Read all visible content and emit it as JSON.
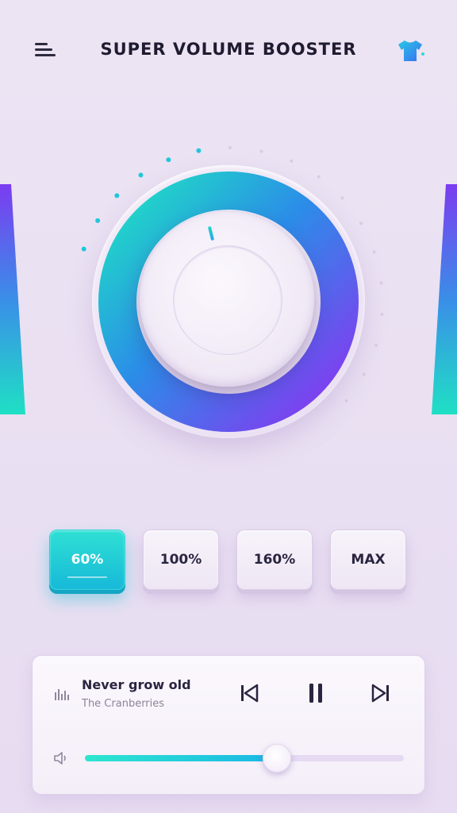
{
  "header": {
    "title": "SUPER VOLUME BOOSTER",
    "menu_icon": "hamburger-menu-icon",
    "theme_icon": "tshirt-theme-icon"
  },
  "booster": {
    "level_fraction": 0.6,
    "knob_colors": [
      "#1fe0c4",
      "#2b8de8",
      "#7a3cf0"
    ]
  },
  "presets": [
    {
      "label": "60%",
      "active": true
    },
    {
      "label": "100%",
      "active": false
    },
    {
      "label": "160%",
      "active": false
    },
    {
      "label": "MAX",
      "active": false
    }
  ],
  "player": {
    "song_title": "Never grow old",
    "artist": "The Cranberries",
    "controls": [
      "previous-icon",
      "pause-icon",
      "next-icon"
    ],
    "volume_fraction": 0.6
  },
  "colors": {
    "accent_teal": "#2fe0d4",
    "accent_blue": "#1ab7e6",
    "accent_purple": "#7a3cf0",
    "background": "#ece4f3"
  }
}
